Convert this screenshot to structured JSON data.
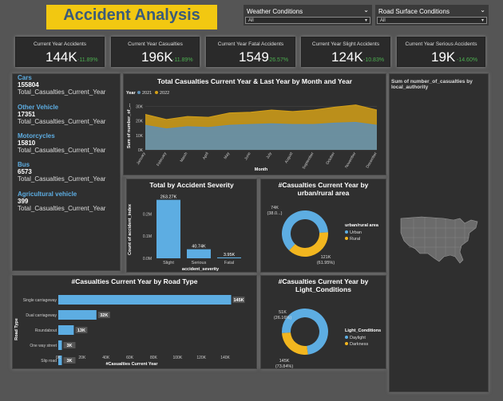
{
  "header": {
    "title": "Accident Analysis"
  },
  "slicers": [
    {
      "label": "Weather Conditions",
      "value": "All"
    },
    {
      "label": "Road Surface Conditions",
      "value": "All"
    }
  ],
  "kpis": [
    {
      "label": "Current Year Accidents",
      "value": "144K",
      "change": "-11.89%"
    },
    {
      "label": "Current Year Casualties",
      "value": "196K",
      "change": "-11.89%"
    },
    {
      "label": "Current Year Fatal Accidents",
      "value": "1549",
      "change": "-26.57%"
    },
    {
      "label": "Current Year Slight Accidents",
      "value": "124K",
      "change": "-10.83%"
    },
    {
      "label": "Current Year Serious Accidents",
      "value": "19K",
      "change": "-14.60%"
    }
  ],
  "vehicles": [
    {
      "name": "Cars",
      "value": "155804",
      "sub": "Total_Casualties_Current_Year"
    },
    {
      "name": "Other Vehicle",
      "value": "17351",
      "sub": "Total_Casualties_Current_Year"
    },
    {
      "name": "Motorcycles",
      "value": "15810",
      "sub": "Total_Casualties_Current_Year"
    },
    {
      "name": "Bus",
      "value": "6573",
      "sub": "Total_Casualties_Current_Year"
    },
    {
      "name": "Agricultural vehicle",
      "value": "399",
      "sub": "Total_Casualties_Current_Year"
    }
  ],
  "map": {
    "title": "Sum of number_of_casualties by local_authority"
  },
  "chart_data": [
    {
      "type": "area",
      "title": "Total Casualties Current Year & Last Year by Month and Year",
      "xlabel": "Month",
      "ylabel": "Sum of number_of_...",
      "legend_title": "Year",
      "legend_position": "top-left",
      "categories": [
        "January",
        "February",
        "March",
        "April",
        "May",
        "June",
        "July",
        "August",
        "September",
        "October",
        "November",
        "December"
      ],
      "series": [
        {
          "name": "2021",
          "color": "#5d8fb6",
          "values": [
            17000,
            14500,
            16000,
            15500,
            17000,
            17500,
            18000,
            17500,
            17500,
            18500,
            19000,
            17000
          ]
        },
        {
          "name": "2022",
          "color": "#d4a017",
          "values": [
            24500,
            21000,
            23000,
            22500,
            25500,
            26000,
            27500,
            26500,
            27500,
            29500,
            31000,
            27500
          ]
        }
      ],
      "yticks": [
        "0K",
        "10K",
        "20K",
        "30K"
      ],
      "ylim": [
        0,
        33000
      ],
      "grid": true
    },
    {
      "type": "bar",
      "title": "Total by Accident Severity",
      "xlabel": "accident_severity",
      "ylabel": "Count of accident_index",
      "categories": [
        "Slight",
        "Serious",
        "Fatal"
      ],
      "values": [
        263270,
        40740,
        3950
      ],
      "data_labels": [
        "263.27K",
        "40.74K",
        "3.95K"
      ],
      "yticks": [
        "0.0M",
        "0.1M",
        "0.2M"
      ],
      "ylim": [
        0,
        280000
      ],
      "color": "#5dade2"
    },
    {
      "type": "pie",
      "title": "#Casualties Current Year by urban/rural area",
      "legend_title": "urban/rural area",
      "labels": [
        "Urban",
        "Rural"
      ],
      "values": [
        121,
        74
      ],
      "data_labels": [
        "121K (61.95%)",
        "74K (38.0...)"
      ],
      "colors": [
        "#5dade2",
        "#f2b61f"
      ]
    },
    {
      "type": "bar",
      "orientation": "horizontal",
      "title": "#Casualties Current Year by Road Type",
      "xlabel": "#Casualties Current Year",
      "ylabel": "Road Type",
      "categories": [
        "Single carriageway",
        "Dual carriageway",
        "Roundabout",
        "One way street",
        "Slip road"
      ],
      "values": [
        145,
        32,
        13,
        3,
        3
      ],
      "data_labels": [
        "145K",
        "32K",
        "13K",
        "3K",
        "3K"
      ],
      "xticks": [
        "0K",
        "20K",
        "40K",
        "60K",
        "80K",
        "100K",
        "120K",
        "140K"
      ],
      "xlim": [
        0,
        150
      ],
      "color": "#5dade2"
    },
    {
      "type": "pie",
      "title": "#Casualties Current Year by Light_Conditions",
      "legend_title": "Light_Conditions",
      "labels": [
        "Daylight",
        "Darkness"
      ],
      "values": [
        145,
        51
      ],
      "data_labels": [
        "145K (73.84%)",
        "51K (26.16%)"
      ],
      "colors": [
        "#5dade2",
        "#f2b61f"
      ]
    }
  ]
}
